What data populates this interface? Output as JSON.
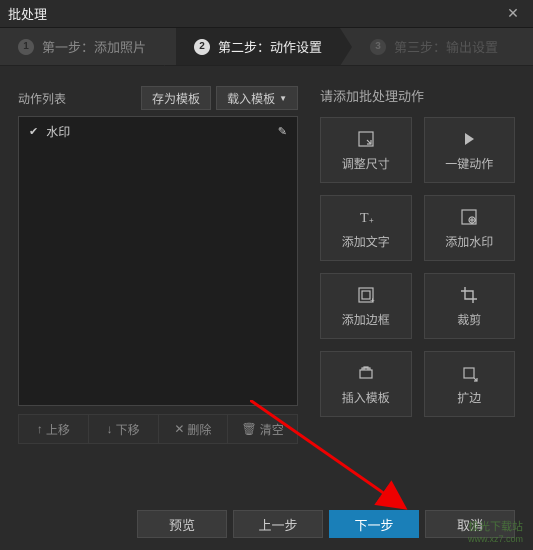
{
  "window": {
    "title": "批处理"
  },
  "steps": [
    {
      "num": "1",
      "label": "第一步：添加照片"
    },
    {
      "num": "2",
      "label": "第二步：动作设置"
    },
    {
      "num": "3",
      "label": "第三步：输出设置"
    }
  ],
  "leftPanel": {
    "title": "动作列表",
    "saveTemplate": "存为模板",
    "loadTemplate": "载入模板",
    "items": [
      {
        "label": "水印"
      }
    ],
    "controls": {
      "up": "上移",
      "down": "下移",
      "delete": "删除",
      "clear": "清空"
    }
  },
  "rightPanel": {
    "title": "请添加批处理动作",
    "actions": [
      {
        "name": "resize",
        "label": "调整尺寸"
      },
      {
        "name": "oneclick",
        "label": "一键动作"
      },
      {
        "name": "addtext",
        "label": "添加文字"
      },
      {
        "name": "watermark",
        "label": "添加水印"
      },
      {
        "name": "border",
        "label": "添加边框"
      },
      {
        "name": "crop",
        "label": "裁剪"
      },
      {
        "name": "template",
        "label": "插入模板"
      },
      {
        "name": "expand",
        "label": "扩边"
      }
    ]
  },
  "footer": {
    "preview": "预览",
    "prev": "上一步",
    "next": "下一步",
    "cancel": "取消"
  },
  "watermark": {
    "line1": "极光下载站",
    "line2": "www.xz7.com"
  }
}
